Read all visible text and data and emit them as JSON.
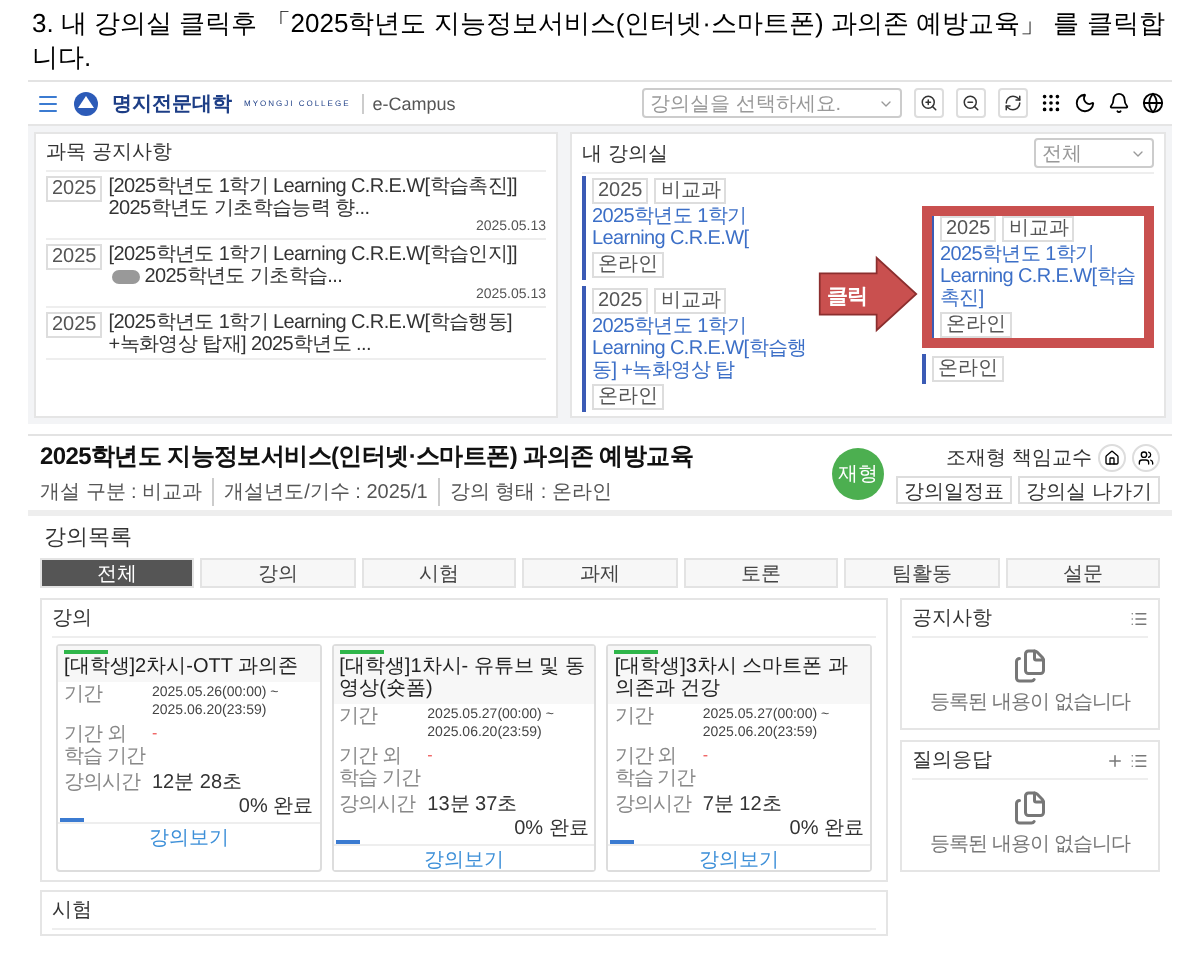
{
  "instruction": "3. 내 강의실 클릭후 「2025학년도 지능정보서비스(인터넷·스마트폰) 과의존 예방교육」 를 클릭합니다.",
  "campus": {
    "brand": "명지전문대학",
    "brand_sub": "MYONGJI COLLEGE",
    "app": "e-Campus",
    "classroom_select": {
      "placeholder": "강의실을 선택하세요."
    },
    "notices": {
      "title": "과목 공지사항",
      "items": [
        {
          "year": "2025",
          "title": "[2025학년도 1학기 Learning C.R.E.W[학습촉진]]",
          "text": "2025학년도 기초학습능력 향...",
          "masked": false,
          "date": "2025.05.13"
        },
        {
          "year": "2025",
          "title": "[2025학년도 1학기 Learning C.R.E.W[학습인지]]",
          "text": "2025학년도 기초학습...",
          "masked": true,
          "date": "2025.05.13"
        },
        {
          "year": "2025",
          "title": "[2025학년도 1학기 Learning C.R.E.W[학습행동] +녹화영상 탑재]",
          "text": "2025학년도 ...",
          "masked": false
        }
      ]
    },
    "my_classroom": {
      "title": "내 강의실",
      "filter": "전체",
      "columns": [
        [
          {
            "year": "2025",
            "type": "비교과",
            "title": "2025학년도 1학기 Learning C.R.E.W[",
            "mode": "온라인",
            "highlighted": false
          },
          {
            "year": "2025",
            "type": "비교과",
            "title": "2025학년도 1학기 Learning C.R.E.W[학습행동] +녹화영상 탑",
            "mode": "온라인",
            "highlighted": false
          }
        ],
        [
          {
            "year": "2025",
            "type": "비교과",
            "title": "2025학년도 1학기 Learning C.R.E.W[학습촉진]",
            "mode": "온라인",
            "highlighted": true
          },
          {
            "mode": "온라인",
            "highlighted": false
          }
        ]
      ]
    },
    "callout": "클릭"
  },
  "course": {
    "title": "2025학년도 지능정보서비스(인터넷·스마트폰) 과의존 예방교육",
    "meta": [
      "개설 구분 : 비교과",
      "개설년도/기수 : 2025/1",
      "강의 형태 : 온라인"
    ],
    "avatar": "재형",
    "professor": "조재형 책임교수",
    "buttons": [
      "강의일정표",
      "강의실 나가기"
    ],
    "section_title": "강의목록",
    "tabs": [
      {
        "label": "전체",
        "selected": true
      },
      {
        "label": "강의",
        "selected": false
      },
      {
        "label": "시험",
        "selected": false
      },
      {
        "label": "과제",
        "selected": false
      },
      {
        "label": "토론",
        "selected": false
      },
      {
        "label": "팀활동",
        "selected": false
      },
      {
        "label": "설문",
        "selected": false
      }
    ],
    "lectures": {
      "title": "강의",
      "cards": [
        {
          "title": "[대학생]2차시-OTT 과의존",
          "period_label": "기간",
          "period": [
            "2025.05.26(00:00) ~",
            "2025.06.20(23:59)"
          ],
          "extra_label": "기간 외 학습 기간",
          "extra_value": "-",
          "time_label": "강의시간",
          "time": "12분 28초",
          "progress": "0% 완료",
          "action": "강의보기"
        },
        {
          "title": "[대학생]1차시- 유튜브 및 동영상(숏폼)",
          "period_label": "기간",
          "period": [
            "2025.05.27(00:00) ~",
            "2025.06.20(23:59)"
          ],
          "extra_label": "기간 외 학습 기간",
          "extra_value": "-",
          "time_label": "강의시간",
          "time": "13분 37초",
          "progress": "0% 완료",
          "action": "강의보기"
        },
        {
          "title": "[대학생]3차시 스마트폰 과의존과 건강",
          "period_label": "기간",
          "period": [
            "2025.05.27(00:00) ~",
            "2025.06.20(23:59)"
          ],
          "extra_label": "기간 외 학습 기간",
          "extra_value": "-",
          "time_label": "강의시간",
          "time": "7분 12초",
          "progress": "0% 완료",
          "action": "강의보기"
        }
      ]
    },
    "exam": {
      "title": "시험"
    },
    "side_panels": [
      {
        "title": "공지사항",
        "empty": "등록된 내용이 없습니다",
        "can_add": false
      },
      {
        "title": "질의응답",
        "empty": "등록된 내용이 없습니다",
        "can_add": true
      }
    ]
  }
}
